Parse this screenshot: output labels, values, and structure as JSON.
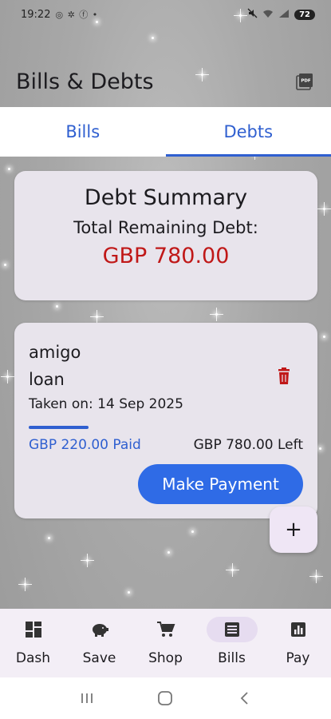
{
  "status_bar": {
    "time": "19:22",
    "indicators": "◎ ✲ ⓕ •",
    "battery": "72"
  },
  "app_bar": {
    "title": "Bills & Debts",
    "pdf_icon": "pdf-icon"
  },
  "tabs": [
    {
      "label": "Bills",
      "active": false
    },
    {
      "label": "Debts",
      "active": true
    }
  ],
  "summary": {
    "title": "Debt Summary",
    "subtitle": "Total Remaining Debt:",
    "amount": "GBP 780.00",
    "amount_color": "#c01818"
  },
  "debt": {
    "name": "amigo",
    "description": "loan",
    "taken_on": "Taken on: 14 Sep 2025",
    "paid": "GBP 220.00 Paid",
    "left": "GBP 780.00 Left",
    "progress_fraction": 0.22,
    "pay_label": "Make Payment",
    "delete_icon": "trash-icon"
  },
  "fab": {
    "label": "+"
  },
  "bottom_nav": [
    {
      "label": "Dash",
      "icon": "dashboard-icon",
      "active": false
    },
    {
      "label": "Save",
      "icon": "piggy-bank-icon",
      "active": false
    },
    {
      "label": "Shop",
      "icon": "cart-icon",
      "active": false
    },
    {
      "label": "Bills",
      "icon": "receipt-icon",
      "active": true
    },
    {
      "label": "Pay",
      "icon": "chart-icon",
      "active": false
    }
  ],
  "colors": {
    "accent": "#2f5fd0",
    "debt_red": "#c01818",
    "card_bg": "#e8e4ec"
  }
}
